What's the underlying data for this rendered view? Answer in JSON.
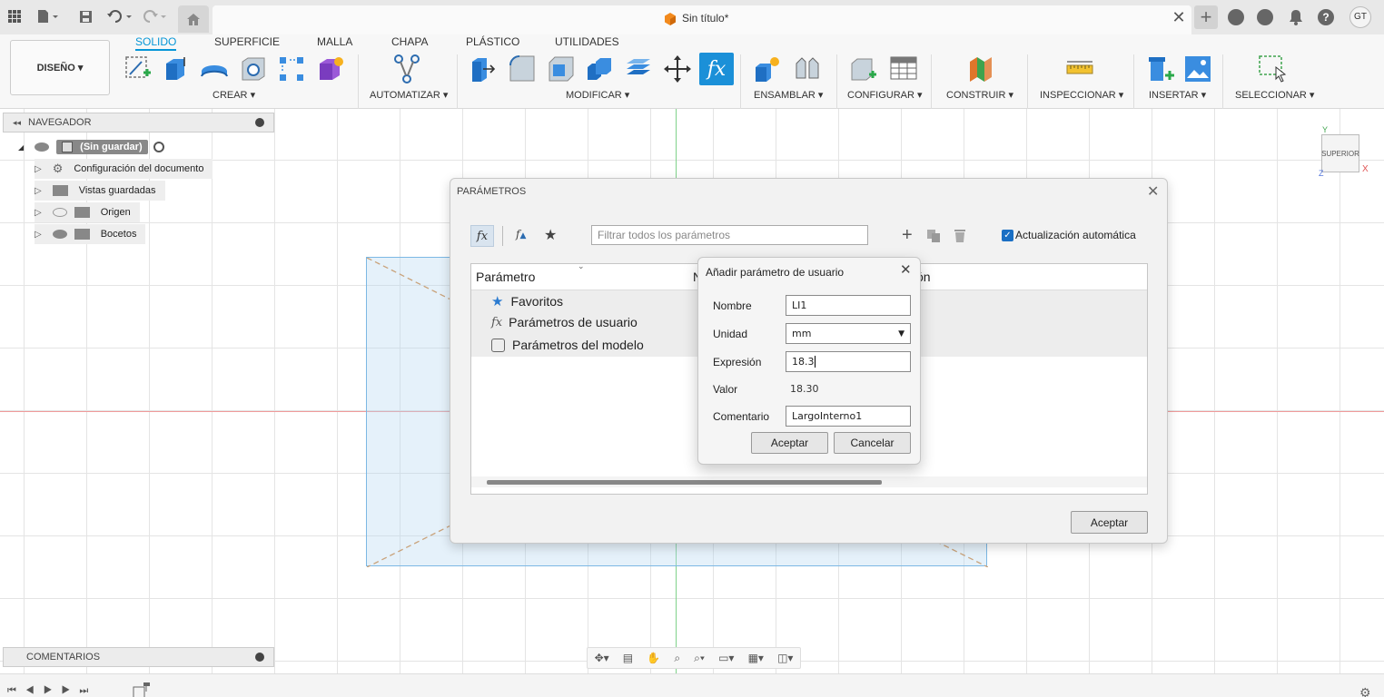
{
  "window": {
    "title": "Sin título*",
    "avatar": "GT"
  },
  "ribbon": {
    "design_button": "DISEÑO",
    "tabs": [
      "SOLIDO",
      "SUPERFICIE",
      "MALLA",
      "CHAPA",
      "PLÁSTICO",
      "UTILIDADES"
    ],
    "groups": [
      "CREAR",
      "AUTOMATIZAR",
      "MODIFICAR",
      "ENSAMBLAR",
      "CONFIGURAR",
      "CONSTRUIR",
      "INSPECCIONAR",
      "INSERTAR",
      "SELECCIONAR"
    ]
  },
  "browser": {
    "title": "NAVEGADOR",
    "root": "(Sin guardar)",
    "items": [
      "Configuración del documento",
      "Vistas guardadas",
      "Origen",
      "Bocetos"
    ]
  },
  "comments": {
    "title": "COMENTARIOS"
  },
  "viewcube": {
    "face": "SUPERIOR",
    "axis_x": "X",
    "axis_y": "Y",
    "axis_z": "Z"
  },
  "params_dialog": {
    "title": "PARÁMETROS",
    "filter_placeholder": "Filtrar todos los parámetros",
    "auto_update": "Actualización automática",
    "col_param": "Parámetro",
    "col_name_partial": "N",
    "col_right_partial": "ón",
    "rows": [
      "Favoritos",
      "Parámetros de usuario",
      "Parámetros del modelo"
    ],
    "ok": "Aceptar"
  },
  "add_dialog": {
    "title": "Añadir parámetro de usuario",
    "name_label": "Nombre",
    "name_value": "LI1",
    "unit_label": "Unidad",
    "unit_value": "mm",
    "expr_label": "Expresión",
    "expr_value": "18.3",
    "value_label": "Valor",
    "value_value": "18.30",
    "comment_label": "Comentario",
    "comment_value": "LargoInterno1",
    "ok": "Aceptar",
    "cancel": "Cancelar"
  }
}
